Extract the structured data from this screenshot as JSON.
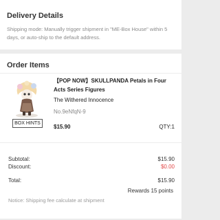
{
  "delivery": {
    "title": "Delivery Details",
    "note": "Shipping mode: Manually trigger shipment in \"ME-Box House\" within 5 days, or auto-ship to the default address."
  },
  "order": {
    "title": "Order Items",
    "item": {
      "name": "【POP NOW】SKULLPANDA Petals in Four Acts Series Figures",
      "variant": "The Withered Innocence",
      "code": "No.9eNfqN-9",
      "price": "$15.90",
      "qty": "QTY:1",
      "box_hints": "BOX HINTS"
    },
    "summary": {
      "subtotal_label": "Subtotal:",
      "subtotal_value": "$15.90",
      "discount_label": "Discount:",
      "discount_value": "$0.00",
      "total_label": "Total:",
      "total_value": "$15.90",
      "rewards": "Rewards 15 points",
      "shipping_note": "Notice: Shipping fee calculate at shipment"
    },
    "colors": {
      "discount": "#e24848",
      "background": "#ececec"
    }
  }
}
